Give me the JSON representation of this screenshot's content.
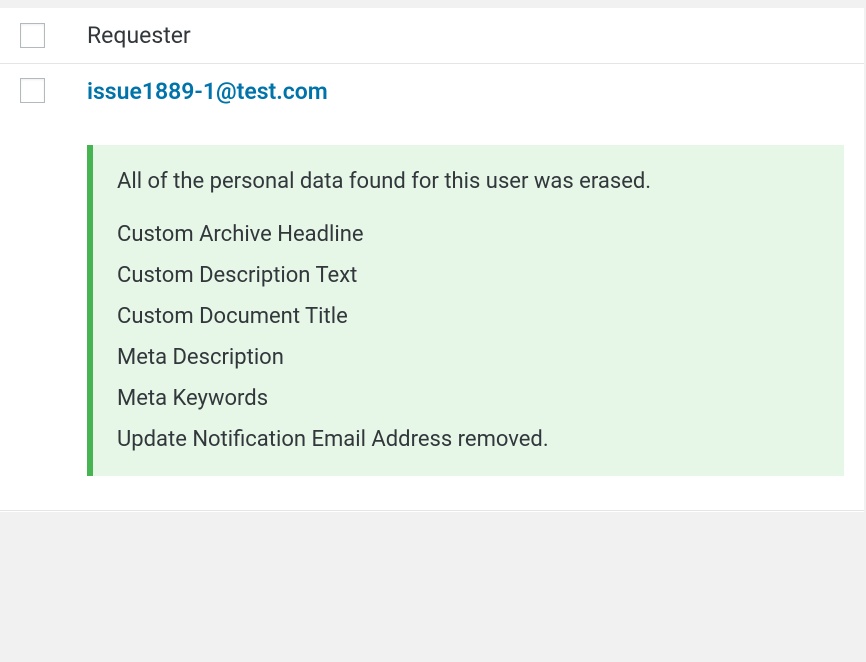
{
  "table": {
    "header_label": "Requester",
    "rows": [
      {
        "requester": "issue1889-1@test.com",
        "notice": {
          "main": "All of the personal data found for this user was erased.",
          "items": [
            "Custom Archive Headline",
            "Custom Description Text",
            "Custom Document Title",
            "Meta Description",
            "Meta Keywords",
            "Update Notification Email Address removed."
          ]
        }
      }
    ]
  }
}
